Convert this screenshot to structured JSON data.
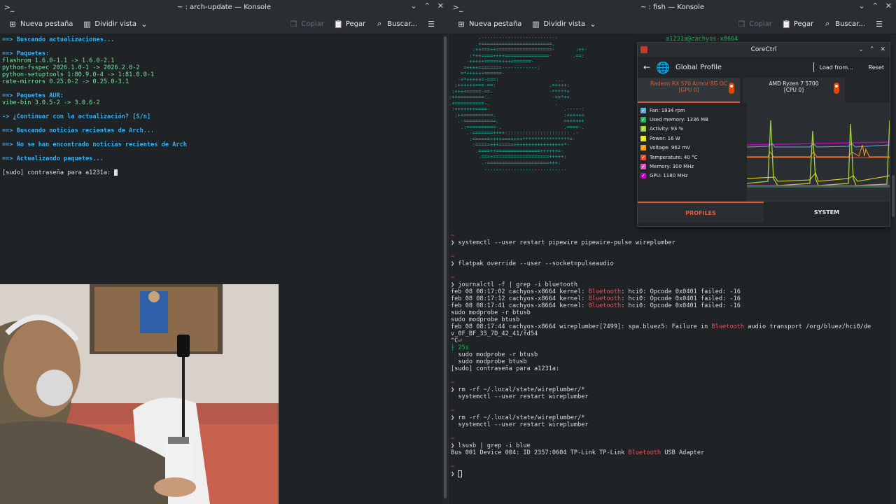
{
  "left_window": {
    "title": "~ : arch-update — Konsole",
    "toolbar": {
      "new_tab": "Nueva pestaña",
      "split": "Dividir vista",
      "copy": "Copiar",
      "paste": "Pegar",
      "search": "Buscar..."
    },
    "lines": [
      {
        "t": "==> Buscando actualizaciones...",
        "c": "c-cyan"
      },
      {
        "t": "",
        "c": ""
      },
      {
        "t": "==> Paquetes:",
        "c": "c-cyan"
      },
      {
        "t": "flashrom 1.6.0-1.1 -> 1.6.0-2.1",
        "c": "c-green"
      },
      {
        "t": "python-fsspec 2026.1.0-1 -> 2026.2.0-2",
        "c": "c-green"
      },
      {
        "t": "python-setuptools 1:80.9.0-4 -> 1:81.0.0-1",
        "c": "c-green"
      },
      {
        "t": "rate-mirrors 0.25.0-2 -> 0.25.0-3.1",
        "c": "c-green"
      },
      {
        "t": "",
        "c": ""
      },
      {
        "t": "==> Paquetes AUR:",
        "c": "c-cyan"
      },
      {
        "t": "vibe-bin 3.0.5-2 -> 3.0.6-2",
        "c": "c-green"
      },
      {
        "t": "",
        "c": ""
      },
      {
        "t": "-> ¿Continuar con la actualización? [S/n]",
        "c": "c-cyan"
      },
      {
        "t": "",
        "c": ""
      },
      {
        "t": "==> Buscando noticias recientes de Arch...",
        "c": "c-cyan"
      },
      {
        "t": "",
        "c": ""
      },
      {
        "t": "==> No se han encontrado noticias recientes de Arch",
        "c": "c-cyan"
      },
      {
        "t": "",
        "c": ""
      },
      {
        "t": "==> Actualizando paquetes...",
        "c": "c-cyan"
      },
      {
        "t": "",
        "c": ""
      },
      {
        "t": "[sudo] contraseña para a1231a: ",
        "c": ""
      }
    ]
  },
  "right_window": {
    "title": "~ : fish — Konsole",
    "toolbar": {
      "new_tab": "Nueva pestaña",
      "split": "Dividir vista",
      "copy": "Copiar",
      "paste": "Pegar",
      "search": "Buscar..."
    },
    "host": "a1231a@cachyos-x8664",
    "lines": [
      {
        "t": "~",
        "c": "c-red"
      },
      {
        "t": "❯ systemctl --user restart pipewire pipewire-pulse wireplumber",
        "c": ""
      },
      {
        "t": "",
        "c": ""
      },
      {
        "t": "~",
        "c": "c-red"
      },
      {
        "t": "❯ flatpak override --user --socket=pulseaudio",
        "c": ""
      },
      {
        "t": "",
        "c": ""
      },
      {
        "t": "~",
        "c": "c-red"
      },
      {
        "t": "❯ journalctl -f | grep -i bluetooth",
        "c": ""
      },
      {
        "t": "feb 08 08:17:02 cachyos-x8664 kernel: Bluetooth: hci0: Opcode 0x0401 failed: -16",
        "c": ""
      },
      {
        "t": "feb 08 08:17:12 cachyos-x8664 kernel: Bluetooth: hci0: Opcode 0x0401 failed: -16",
        "c": ""
      },
      {
        "t": "feb 08 08:17:41 cachyos-x8664 kernel: Bluetooth: hci0: Opcode 0x0401 failed: -16",
        "c": ""
      },
      {
        "t": "sudo modprobe -r btusb",
        "c": ""
      },
      {
        "t": "sudo modprobe btusb",
        "c": ""
      },
      {
        "t": "feb 08 08:17:44 cachyos-x8664 wireplumber[7499]: spa.bluez5: Failure in Bluetooth audio transport /org/bluez/hci0/de",
        "c": ""
      },
      {
        "t": "v_0F_BF_35_7D_42_41/fd54",
        "c": ""
      },
      {
        "t": "^C⏎",
        "c": ""
      },
      {
        "t": "├ 25s",
        "c": "c-grn2"
      },
      {
        "t": "  sudo modprobe -r btusb",
        "c": ""
      },
      {
        "t": "  sudo modprobe btusb",
        "c": ""
      },
      {
        "t": "[sudo] contraseña para a1231a:",
        "c": ""
      },
      {
        "t": "",
        "c": ""
      },
      {
        "t": "~",
        "c": "c-red"
      },
      {
        "t": "❯ rm -rf ~/.local/state/wireplumber/*",
        "c": ""
      },
      {
        "t": "  systemctl --user restart wireplumber",
        "c": ""
      },
      {
        "t": "",
        "c": ""
      },
      {
        "t": "~",
        "c": "c-red"
      },
      {
        "t": "❯ rm -rf ~/.local/state/wireplumber/*",
        "c": ""
      },
      {
        "t": "  systemctl --user restart wireplumber",
        "c": ""
      },
      {
        "t": "",
        "c": ""
      },
      {
        "t": "~",
        "c": "c-red"
      },
      {
        "t": "❯ lsusb | grep -i blue",
        "c": ""
      },
      {
        "t": "Bus 001 Device 004: ID 2357:0604 TP-Link TP-Link Bluetooth USB Adapter",
        "c": ""
      },
      {
        "t": "",
        "c": ""
      },
      {
        "t": "~",
        "c": "c-red"
      },
      {
        "t": "❯ ",
        "c": ""
      }
    ]
  },
  "corectrl": {
    "title": "CoreCtrl",
    "profile_name": "Global Profile",
    "load_from": "Load from...",
    "reset": "Reset",
    "device_gpu": "Radeon RX 570 Armor 8G OC",
    "device_gpu_sub": "[GPU 0]",
    "device_cpu": "AMD Ryzen 7 5700",
    "device_cpu_sub": "[CPU 0]",
    "legend": [
      {
        "label": "Fan: 1934 rpm",
        "color": "#5dade2"
      },
      {
        "label": "Used memory: 1336 MB",
        "color": "#27ae60"
      },
      {
        "label": "Activity: 93 %",
        "color": "#a3d13a"
      },
      {
        "label": "Power: 16 W",
        "color": "#f1e31b"
      },
      {
        "label": "Voltage: 962 mV",
        "color": "#f39c12"
      },
      {
        "label": "Temperature: 40 °C",
        "color": "#e74c3c"
      },
      {
        "label": "Memory: 300 MHz",
        "color": "#d957c9"
      },
      {
        "label": "GPU: 1180 MHz",
        "color": "#c100c1"
      }
    ],
    "tab_profiles": "PROFILES",
    "tab_system": "SYSTEM"
  }
}
